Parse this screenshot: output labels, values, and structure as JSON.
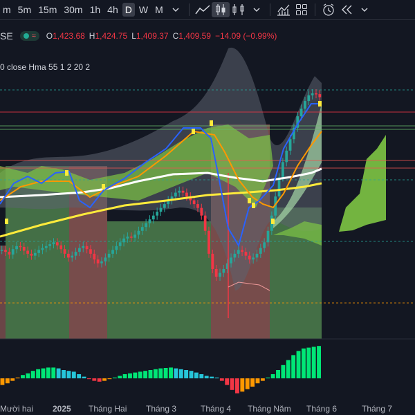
{
  "toolbar": {
    "timeframes": [
      "m",
      "5m",
      "15m",
      "30m",
      "1h",
      "4h",
      "D",
      "W",
      "M"
    ],
    "active_timeframe": "D",
    "icons": [
      "chevron-down-icon",
      "line-tool-icon",
      "candles-icon",
      "chart-type-icon",
      "chevron-down-icon",
      "indicators-icon",
      "layout-grid-icon",
      "alert-clock-icon",
      "replay-icon",
      "chevron-down-icon"
    ]
  },
  "legend": {
    "symbol": "SE",
    "open_label": "O",
    "open": "1,423.68",
    "high_label": "H",
    "high": "1,424.75",
    "low_label": "L",
    "low": "1,409.37",
    "close_label": "C",
    "close": "1,409.59",
    "change": "−14.09 (−0.99%)",
    "indicator": "0 close Hma 55 1 2 20 2"
  },
  "axis": {
    "labels": [
      "Mười hai",
      "2025",
      "Tháng Hai",
      "Tháng 3",
      "Tháng 4",
      "Tháng Năm",
      "Tháng 6",
      "Tháng 7"
    ]
  },
  "colors": {
    "background": "#131722",
    "up": "#089981",
    "down": "#f23645",
    "hma": "#2962ff",
    "ema_fast": "#ff9800",
    "ema_mid": "#ffeb3b",
    "ema_slow": "#ffffff",
    "cloud_green": "#7ec544",
    "zone_red": "#a0524e",
    "zone_green": "#4caf50"
  },
  "chart_data": {
    "type": "candlestick",
    "price_open": 1423.68,
    "price_high": 1424.75,
    "price_low": 1409.37,
    "price_close": 1409.59,
    "x_labels": [
      "Mười hai",
      "2025",
      "Tháng Hai",
      "Tháng 3",
      "Tháng 4",
      "Tháng Năm",
      "Tháng 6",
      "Tháng 7"
    ],
    "close_series": [
      1010,
      1005,
      998,
      1012,
      1020,
      1018,
      1008,
      1000,
      995,
      1002,
      1010,
      1015,
      1020,
      1025,
      1030,
      1022,
      1012,
      1000,
      990,
      995,
      1005,
      1015,
      1020,
      1012,
      1000,
      985,
      975,
      980,
      990,
      1000,
      1010,
      1020,
      1030,
      1040,
      1045,
      1042,
      1050,
      1060,
      1070,
      1080,
      1090,
      1100,
      1110,
      1120,
      1130,
      1140,
      1150,
      1160,
      1165,
      1160,
      1150,
      1140,
      1130,
      1120,
      1100,
      1060,
      1000,
      960,
      940,
      950,
      960,
      975,
      990,
      1000,
      1010,
      1005,
      995,
      985,
      990,
      1000,
      1015,
      1030,
      1060,
      1100,
      1150,
      1200,
      1240,
      1270,
      1300,
      1330,
      1360,
      1380,
      1400,
      1415,
      1420,
      1418,
      1410
    ],
    "oscillator_series": [
      -0.8,
      -0.6,
      -0.3,
      0.1,
      0.4,
      0.6,
      0.9,
      1.1,
      1.2,
      1.3,
      1.3,
      1.2,
      1.0,
      0.9,
      0.8,
      0.5,
      0.2,
      -0.1,
      -0.3,
      -0.4,
      -0.3,
      -0.1,
      0.1,
      0.3,
      0.5,
      0.6,
      0.7,
      0.8,
      0.9,
      1.0,
      1.1,
      1.2,
      1.25,
      1.3,
      1.2,
      1.1,
      1.0,
      0.9,
      0.7,
      0.5,
      0.3,
      0.2,
      0.1,
      -0.3,
      -0.8,
      -1.4,
      -1.8,
      -1.6,
      -1.3,
      -1.0,
      -0.6,
      -0.3,
      0.1,
      0.5,
      1.0,
      1.6,
      2.2,
      2.8,
      3.3,
      3.6,
      3.7,
      3.8,
      3.9
    ]
  }
}
